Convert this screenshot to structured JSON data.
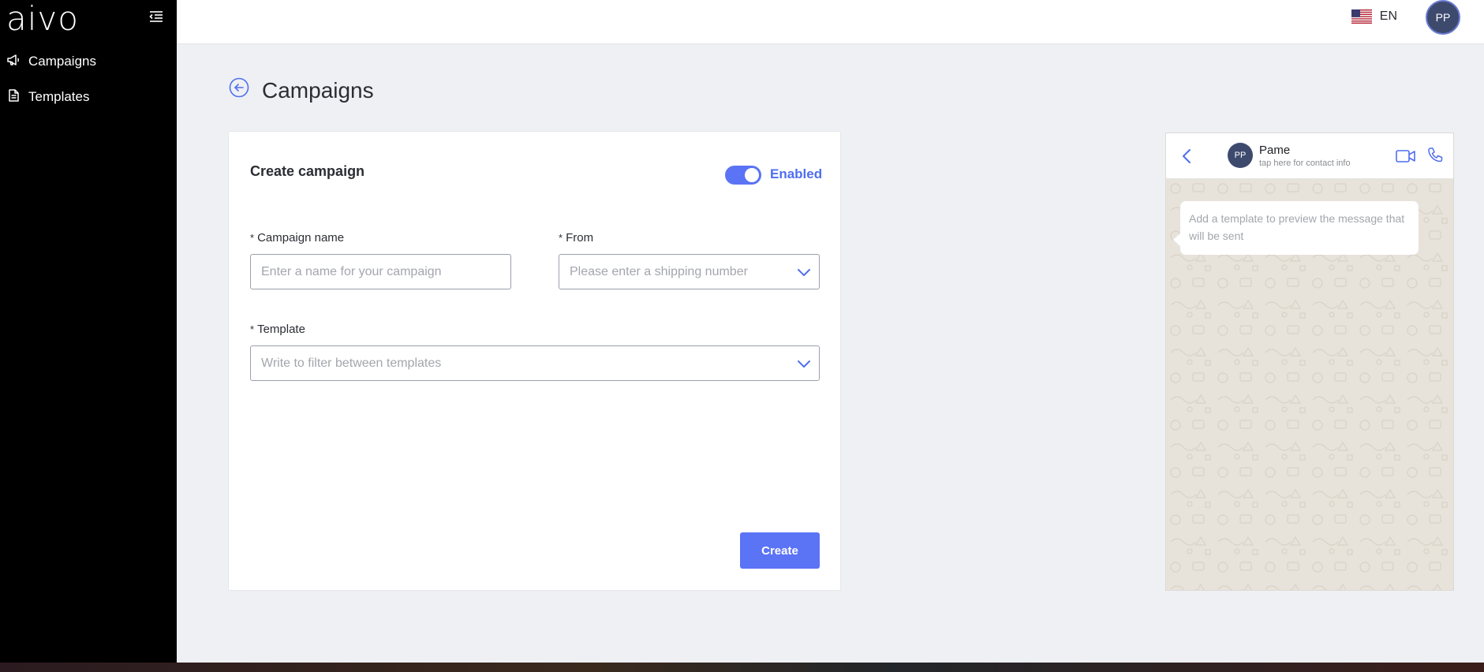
{
  "sidebar": {
    "logo": "aivo",
    "items": [
      {
        "label": "Campaigns",
        "icon": "megaphone-icon"
      },
      {
        "label": "Templates",
        "icon": "document-icon"
      }
    ]
  },
  "topbar": {
    "language": "EN",
    "user_initials": "PP"
  },
  "page": {
    "title": "Campaigns"
  },
  "form": {
    "title": "Create campaign",
    "toggle_label": "Enabled",
    "toggle_on": true,
    "campaign_name": {
      "label": "Campaign name",
      "placeholder": "Enter a name for your campaign",
      "required_mark": "*"
    },
    "from": {
      "label": "From",
      "placeholder": "Please enter a shipping number",
      "required_mark": "*"
    },
    "template": {
      "label": "Template",
      "placeholder": "Write to filter between templates",
      "required_mark": "*"
    },
    "create_label": "Create"
  },
  "preview": {
    "contact_initials": "PP",
    "contact_name": "Pame",
    "contact_sub": "tap here for contact info",
    "message": "Add a template to preview the message that will be sent"
  },
  "colors": {
    "accent": "#5b73f5",
    "sidebar_bg": "#000000",
    "page_bg": "#eff0f4"
  }
}
